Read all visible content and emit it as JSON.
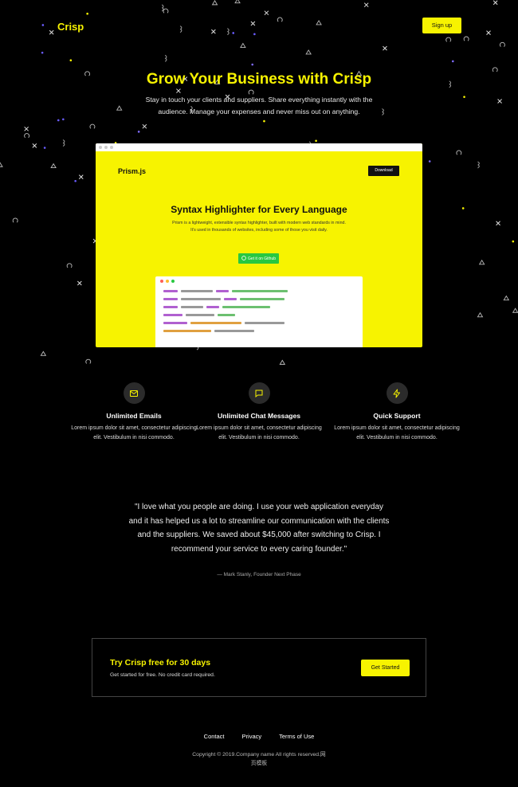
{
  "header": {
    "logo": "Crisp",
    "signup_label": "Sign up"
  },
  "hero": {
    "title": "Grow Your Business with Crisp",
    "subtitle": "Stay in touch your clients and suppliers. Share everything instantly with the audience. Manage your expenses and never miss out on anything."
  },
  "mockup": {
    "logo": "Prism.js",
    "download_label": "Download",
    "title": "Syntax Highlighter for Every Language",
    "description": "Prism is a lightweight, extensible syntax highlighter, built with modern web standards in mind. It's used in thousands of websites, including some of those you visit daily.",
    "github_label": "Get it on Github"
  },
  "features": [
    {
      "icon": "mail-icon",
      "title": "Unlimited Emails",
      "text": "Lorem ipsum dolor sit amet, consectetur adipiscing elit. Vestibulum in nisi commodo."
    },
    {
      "icon": "chat-icon",
      "title": "Unlimited Chat Messages",
      "text": "Lorem ipsum dolor sit amet, consectetur adipiscing elit. Vestibulum in nisi commodo."
    },
    {
      "icon": "lightning-icon",
      "title": "Quick Support",
      "text": "Lorem ipsum dolor sit amet, consectetur adipiscing elit. Vestibulum in nisi commodo."
    }
  ],
  "testimonial": {
    "quote": "\"I love what you people are doing. I use your web application everyday and it has helped us a lot to streamline our communication with the clients and the suppliers. We saved about $45,000 after switching to Crisp. I recommend your service to every caring founder.\"",
    "author": "— Mark Stanly, Founder Next Phase"
  },
  "cta": {
    "title": "Try Crisp free for 30 days",
    "subtitle": "Get started for free. No credit card required.",
    "button_label": "Get Started"
  },
  "footer": {
    "links": [
      "Contact",
      "Privacy",
      "Terms of Use"
    ],
    "copyright": "Copyright © 2019.Company name All rights reserved.网页模板"
  },
  "colors": {
    "accent": "#f7f300",
    "background": "#000000",
    "github_green": "#28c840"
  }
}
